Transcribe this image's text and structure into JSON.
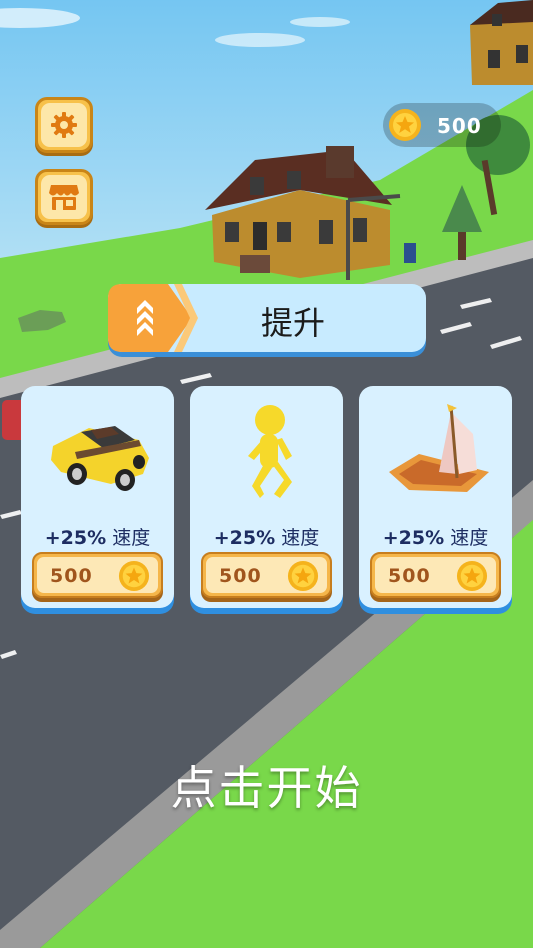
{
  "hud": {
    "settings_icon": "gear-icon",
    "shop_icon": "shop-icon",
    "coins": "500"
  },
  "upgrade": {
    "title": "提升",
    "cards": [
      {
        "item": "car",
        "bonus_value": "+25%",
        "bonus_label": "速度",
        "price": "500"
      },
      {
        "item": "runner",
        "bonus_value": "+25%",
        "bonus_label": "速度",
        "price": "500"
      },
      {
        "item": "boat",
        "bonus_value": "+25%",
        "bonus_label": "速度",
        "price": "500"
      }
    ]
  },
  "prompt": "点击开始",
  "colors": {
    "accent_orange": "#f7a23a",
    "card_bg": "#d9f1ff",
    "card_shadow": "#2f8fe0",
    "text_dark_blue": "#1d2d62"
  }
}
